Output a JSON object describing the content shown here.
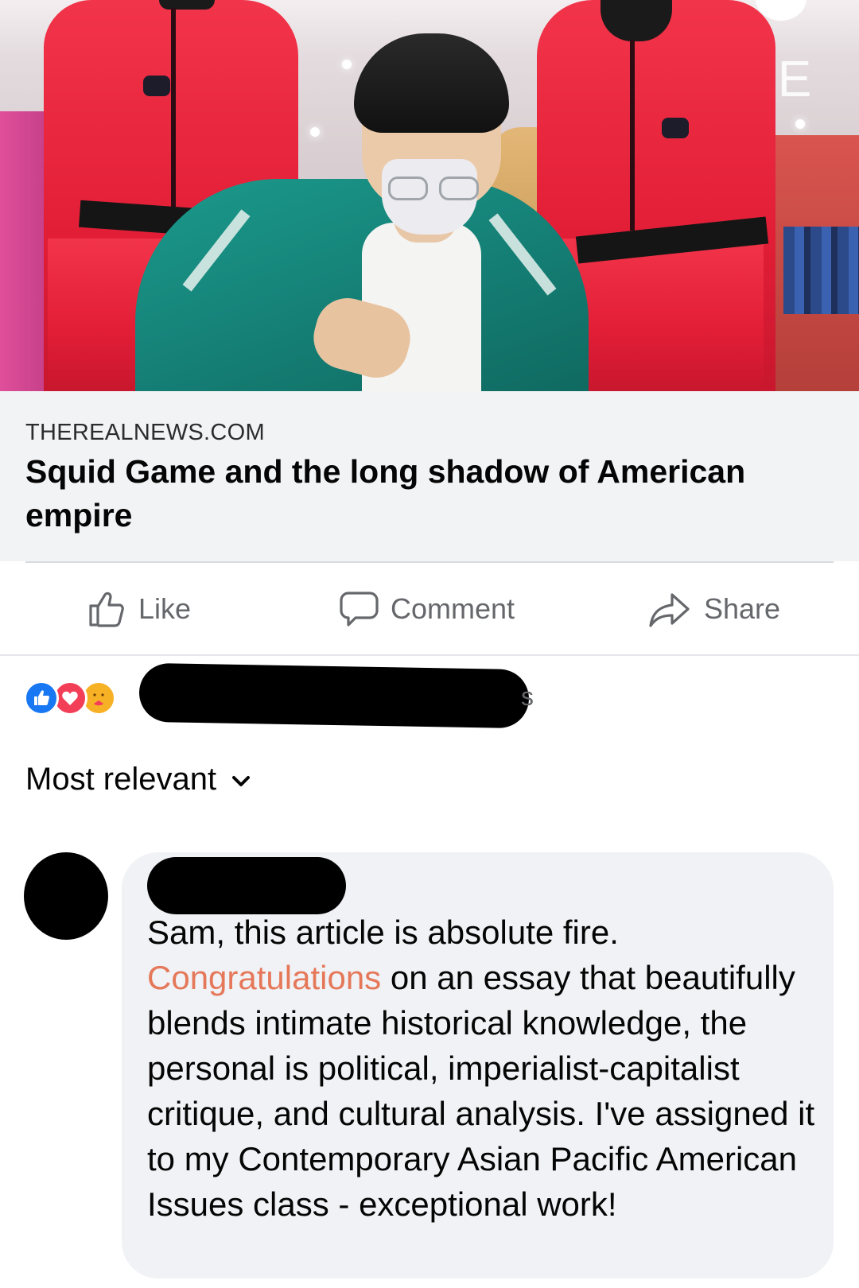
{
  "link_preview": {
    "domain": "THEREALNEWS.COM",
    "title": "Squid Game and the long shadow of American empire",
    "image_sign_text": "LE"
  },
  "actions": {
    "like": "Like",
    "comment": "Comment",
    "share": "Share"
  },
  "reactions": {
    "icons": [
      "like-reaction",
      "love-reaction",
      "care-reaction"
    ],
    "names_visible_tail": "s"
  },
  "comments_sort": {
    "label": "Most relevant"
  },
  "comment": {
    "text_before": "Sam, this article is absolute fire. ",
    "highlight": "Congratulations",
    "text_after": " on an essay that beautifully blends intimate historical knowledge, the personal is political, imperialist-capitalist critique, and cultural analysis. I've assigned it to my Contemporary Asian Pacific American Issues class - exceptional work!"
  },
  "colors": {
    "facebook_blue": "#1877f2",
    "love_red": "#f33e58",
    "care_yellow": "#f7b125",
    "highlight_text": "#e6785a",
    "secondary_text": "#65676b",
    "bubble_bg": "#f0f2f5"
  }
}
